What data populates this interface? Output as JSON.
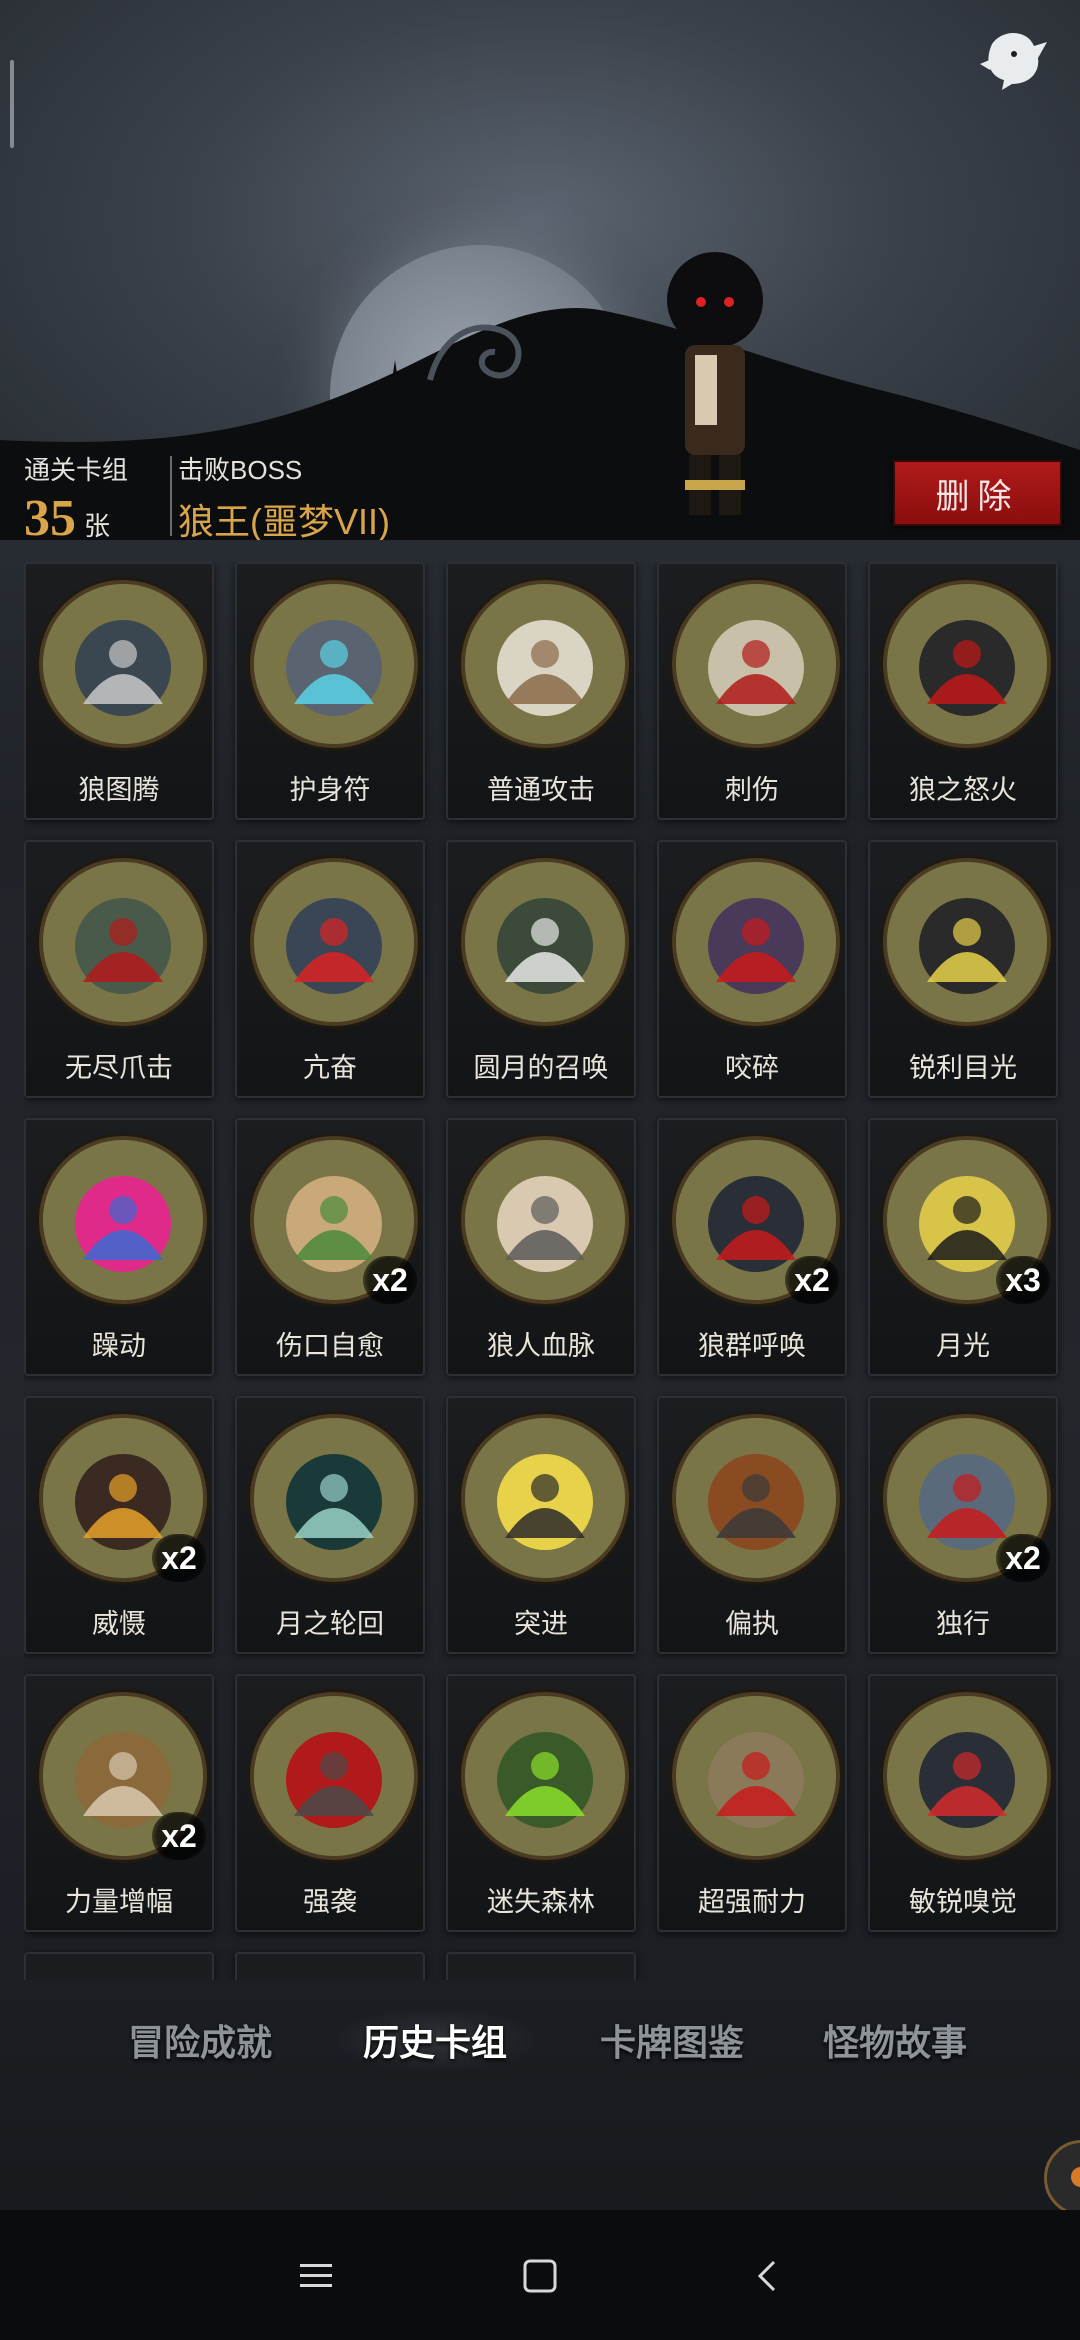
{
  "stats": {
    "clear_deck_label": "通关卡组",
    "clear_deck_count": "35",
    "clear_deck_unit": "张",
    "defeated_boss_label": "击败BOSS",
    "defeated_boss_name": "狼王(噩梦VII)"
  },
  "delete_label": "删除",
  "cards": [
    {
      "name": "狼图腾",
      "mult": ""
    },
    {
      "name": "护身符",
      "mult": ""
    },
    {
      "name": "普通攻击",
      "mult": ""
    },
    {
      "name": "刺伤",
      "mult": ""
    },
    {
      "name": "狼之怒火",
      "mult": ""
    },
    {
      "name": "无尽爪击",
      "mult": ""
    },
    {
      "name": "亢奋",
      "mult": ""
    },
    {
      "name": "圆月的召唤",
      "mult": ""
    },
    {
      "name": "咬碎",
      "mult": ""
    },
    {
      "name": "锐利目光",
      "mult": ""
    },
    {
      "name": "躁动",
      "mult": ""
    },
    {
      "name": "伤口自愈",
      "mult": "x2"
    },
    {
      "name": "狼人血脉",
      "mult": ""
    },
    {
      "name": "狼群呼唤",
      "mult": "x2"
    },
    {
      "name": "月光",
      "mult": "x3"
    },
    {
      "name": "威慑",
      "mult": "x2"
    },
    {
      "name": "月之轮回",
      "mult": ""
    },
    {
      "name": "突进",
      "mult": ""
    },
    {
      "name": "偏执",
      "mult": ""
    },
    {
      "name": "独行",
      "mult": "x2"
    },
    {
      "name": "力量增幅",
      "mult": "x2"
    },
    {
      "name": "强袭",
      "mult": ""
    },
    {
      "name": "迷失森林",
      "mult": ""
    },
    {
      "name": "超强耐力",
      "mult": ""
    },
    {
      "name": "敏锐嗅觉",
      "mult": ""
    }
  ],
  "tabs": [
    {
      "label": "冒险成就",
      "active": false
    },
    {
      "label": "历史卡组",
      "active": true
    },
    {
      "label": "卡牌图鉴",
      "active": false
    },
    {
      "label": "怪物故事",
      "active": false
    }
  ],
  "colors": {
    "accent_gold": "#d9a54a",
    "delete_red": "#a01414",
    "card_art_bg": "#7a7546"
  },
  "icons": {
    "ghost": "ghost-icon",
    "nav_menu": "menu-icon",
    "nav_home": "home-icon",
    "nav_back": "back-icon"
  }
}
